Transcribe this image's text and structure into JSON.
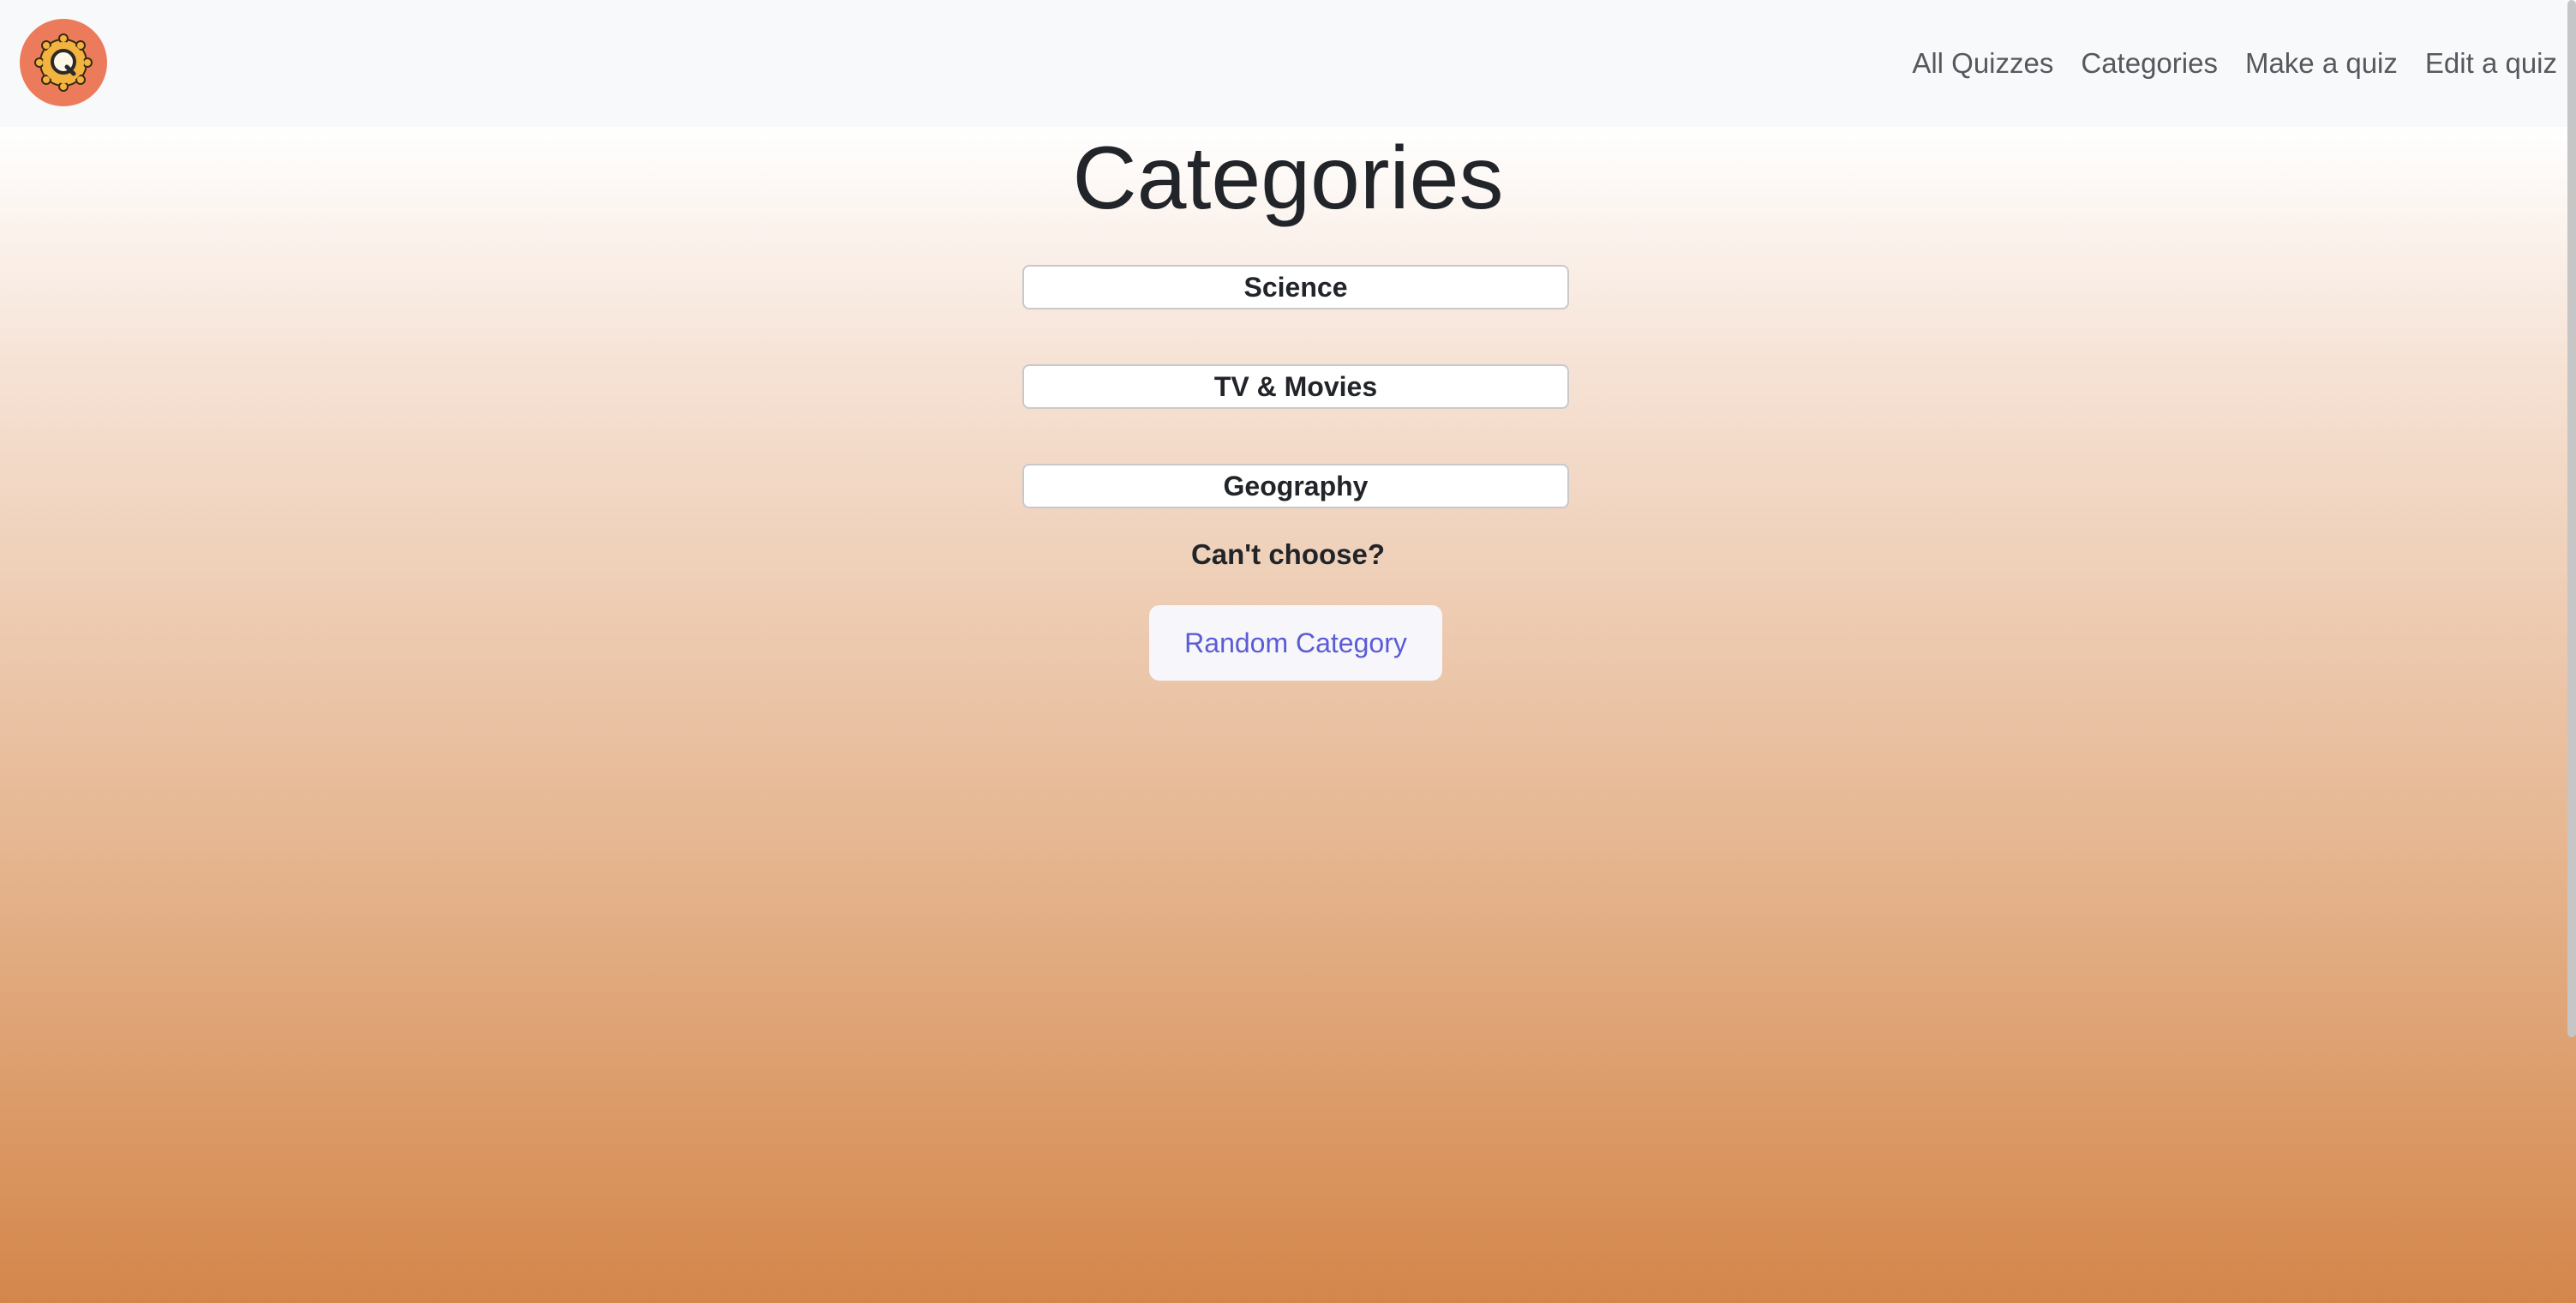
{
  "nav": {
    "logo_icon": "quiz-logo-icon",
    "links": [
      "All Quizzes",
      "Categories",
      "Make a quiz",
      "Edit a quiz"
    ]
  },
  "page": {
    "title": "Categories"
  },
  "categories": [
    "Science",
    "TV & Movies",
    "Geography"
  ],
  "random": {
    "prompt": "Can't choose?",
    "button_label": "Random Category"
  },
  "colors": {
    "logo_bg": "#ec7b5b",
    "logo_gear": "#f3b33f",
    "link_accent": "#5b5bd6",
    "gradient_bottom": "#d4864a"
  }
}
